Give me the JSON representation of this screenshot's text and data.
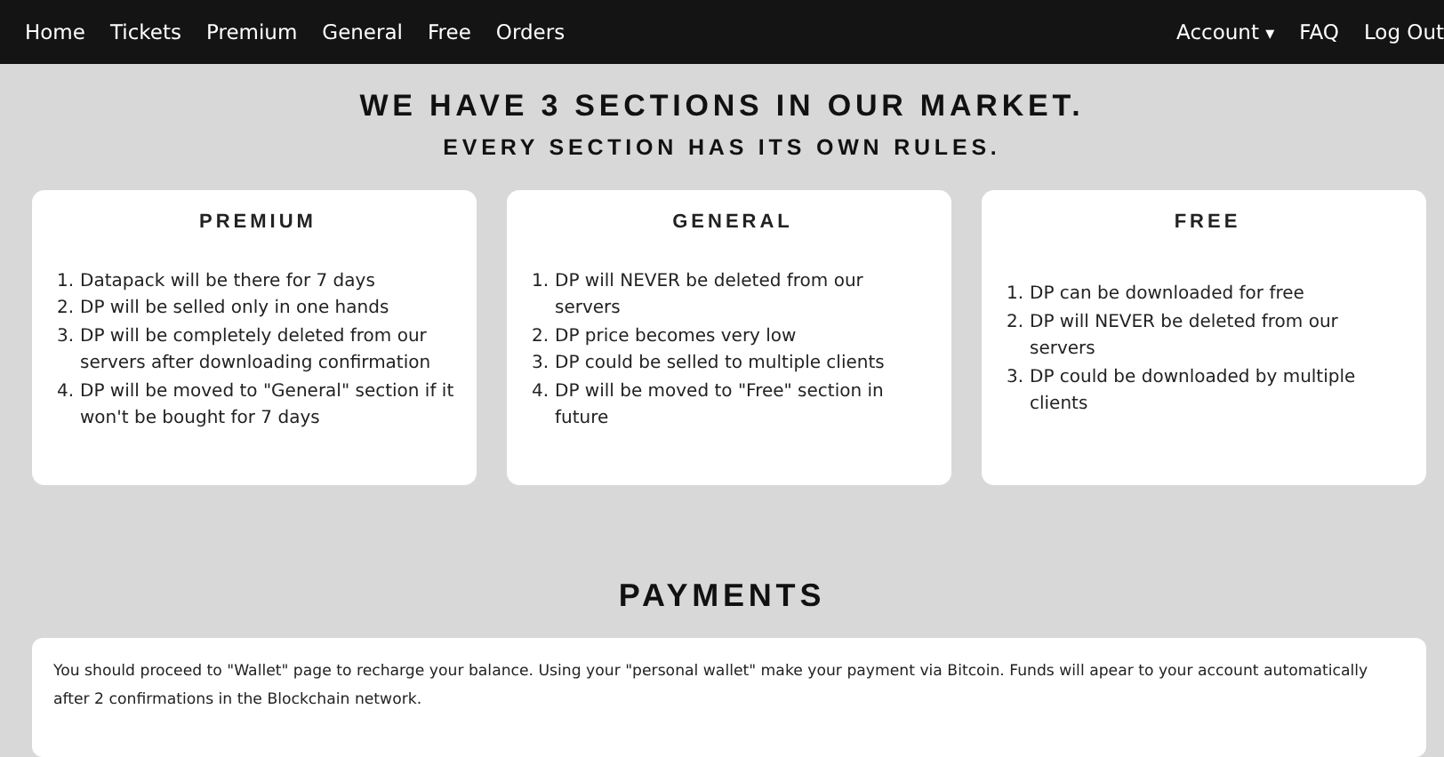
{
  "nav": {
    "left": [
      "Home",
      "Tickets",
      "Premium",
      "General",
      "Free",
      "Orders"
    ],
    "account": "Account",
    "caret": "▾",
    "right": [
      "FAQ",
      "Log Out"
    ]
  },
  "headline": "WE HAVE 3 SECTIONS IN OUR MARKET.",
  "subheadline": "EVERY SECTION HAS ITS OWN RULES.",
  "sections": [
    {
      "title": "PREMIUM",
      "rules": [
        {
          "number": "1.",
          "text": "Datapack will be there for 7 days"
        },
        {
          "number": "2.",
          "text": "DP will be selled only in one hands"
        },
        {
          "number": "3.",
          "text": "DP will be completely deleted from our servers after downloading confirmation"
        },
        {
          "number": "4.",
          "text": "DP will be moved to \"General\" section if it won't be bought for 7 days"
        }
      ]
    },
    {
      "title": "GENERAL",
      "rules": [
        {
          "number": "1.",
          "text": "DP will NEVER be deleted from our servers"
        },
        {
          "number": "2.",
          "text": "DP price becomes very low"
        },
        {
          "number": "3.",
          "text": "DP could be selled to multiple clients"
        },
        {
          "number": "4.",
          "text": "DP will be moved to \"Free\" section in future"
        }
      ]
    },
    {
      "title": "FREE",
      "rules": [
        {
          "number": "1.",
          "text": "DP can be downloaded for free"
        },
        {
          "number": "2.",
          "text": "DP will NEVER be deleted from our servers"
        },
        {
          "number": "3.",
          "text": "DP could be downloaded by multiple clients"
        }
      ]
    }
  ],
  "payments": {
    "title": "PAYMENTS",
    "text": "You should proceed to \"Wallet\" page to recharge your balance. Using your \"personal wallet\" make your payment via Bitcoin. Funds will apear to your account automatically after 2 confirmations in the Blockchain network."
  }
}
